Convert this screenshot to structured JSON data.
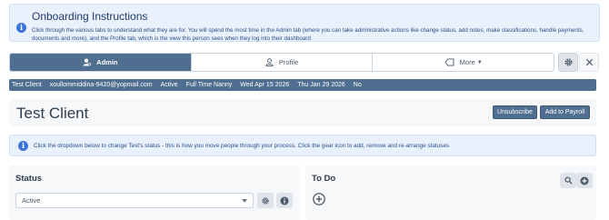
{
  "onboarding": {
    "title": "Onboarding Instructions",
    "body": "Click through the various tabs to understand what they are for. You will spend the most time in the Admin tab (where you can take administrative actions like change status, add notes, make classifications, handle payments, documents and more), and the Profile tab, which is the view this person sees when they log into their dashboard"
  },
  "tabs": [
    {
      "label": "Admin",
      "icon": "admin-user-icon",
      "active": true
    },
    {
      "label": "Profile",
      "icon": "person-icon",
      "active": false
    },
    {
      "label": "More",
      "icon": "tag-icon",
      "active": false
    }
  ],
  "toolbar": {
    "gear_icon": "gear-icon",
    "close_icon": "close-icon"
  },
  "infobar": [
    "Test Client",
    "xoullommiddina-9420@yopmail.com",
    "Active",
    "Full Time Nanny",
    "Wed Apr 15 2026",
    "Thu Jan 29 2026",
    "No"
  ],
  "header": {
    "title": "Test Client",
    "unsubscribe_label": "Unsubscribe",
    "payroll_label": "Add to Payroll"
  },
  "tip": {
    "text": "Click the dropdown below to change Test's status - this is how you move people through your process. Click the gear icon to add, remove and re-arrange statuses"
  },
  "status": {
    "title": "Status",
    "selected": "Active"
  },
  "todo": {
    "title": "To Do"
  },
  "colors": {
    "accent": "#4f6e90",
    "info_bg": "#e9f1fd",
    "info_icon": "#3b73d8"
  }
}
